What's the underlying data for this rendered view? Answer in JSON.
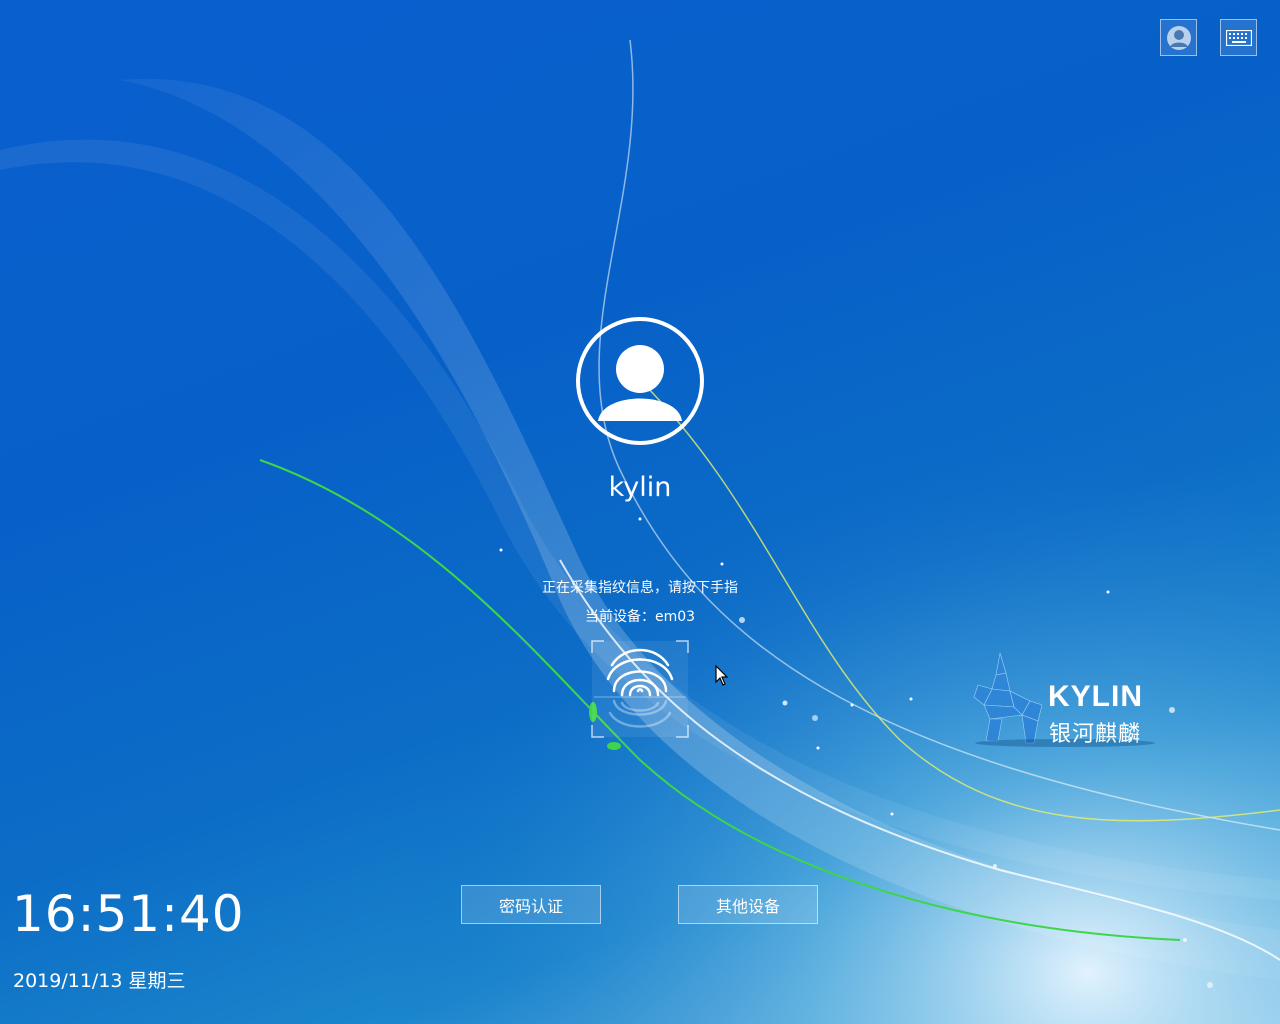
{
  "top_bar": {
    "user_switch_icon": "user-icon",
    "keyboard_icon": "keyboard-icon"
  },
  "login": {
    "username": "kylin",
    "status_message": "正在采集指纹信息，请按下手指",
    "device_line": "当前设备：em03",
    "fingerprint_icon": "fingerprint-icon"
  },
  "buttons": {
    "password_auth": "密码认证",
    "other_device": "其他设备"
  },
  "clock": {
    "time": "16:51:40",
    "date": "2019/11/13 星期三"
  },
  "logo": {
    "brand": "KYLIN",
    "brand_cn": "银河麒麟"
  },
  "colors": {
    "background": "#0760c8",
    "text": "#ffffff",
    "accent_green": "#3ed54a"
  }
}
